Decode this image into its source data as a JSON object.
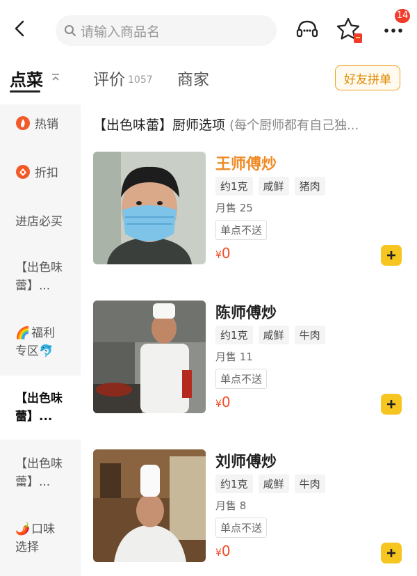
{
  "header": {
    "search_placeholder": "请输入商品名",
    "badge_count": "14",
    "icons": [
      "back-arrow-icon",
      "search-icon",
      "customer-service-icon",
      "favorite-star-icon",
      "more-icon"
    ]
  },
  "tabs": {
    "order": "点菜",
    "review": "评价",
    "review_count": "1057",
    "shop": "商家",
    "group_order": "好友拼单"
  },
  "sidebar": {
    "items": [
      {
        "label": "热销",
        "icon": "hot-icon"
      },
      {
        "label": "折扣",
        "icon": "discount-icon"
      },
      {
        "label": "进店必买"
      },
      {
        "label_line1": "【出色味",
        "label_line2": "蕾】..."
      },
      {
        "emoji": "🌈",
        "label_line1": "福利",
        "label_line2": "专区",
        "emoji2": "🐬"
      },
      {
        "label_line1": "【出色味",
        "label_line2": "蕾】...",
        "active": true
      },
      {
        "label_line1": "【出色味",
        "label_line2": "蕾】..."
      },
      {
        "emoji": "🌶️",
        "label_line1": "口味",
        "label_line2": "选择"
      }
    ]
  },
  "category": {
    "title": "【出色味蕾】厨师选项",
    "desc": "(每个厨师都有自己独..."
  },
  "dishes": [
    {
      "name": "王师傅炒",
      "tags": [
        "约1克",
        "咸鲜",
        "猪肉"
      ],
      "sales": "月售 25",
      "note": "单点不送",
      "currency": "¥",
      "price": "0",
      "name_color": "#f08a24"
    },
    {
      "name": "陈师傅炒",
      "tags": [
        "约1克",
        "咸鲜",
        "牛肉"
      ],
      "sales": "月售 11",
      "note": "单点不送",
      "currency": "¥",
      "price": "0",
      "name_color": "#222222"
    },
    {
      "name": "刘师傅炒",
      "tags": [
        "约1克",
        "咸鲜",
        "牛肉"
      ],
      "sales": "月售 8",
      "note": "单点不送",
      "currency": "¥",
      "price": "0",
      "name_color": "#222222"
    }
  ],
  "colors": {
    "accent": "#f7c51f",
    "price": "#f24a24",
    "badge": "#f23c2b",
    "group_border": "#f0a020"
  }
}
